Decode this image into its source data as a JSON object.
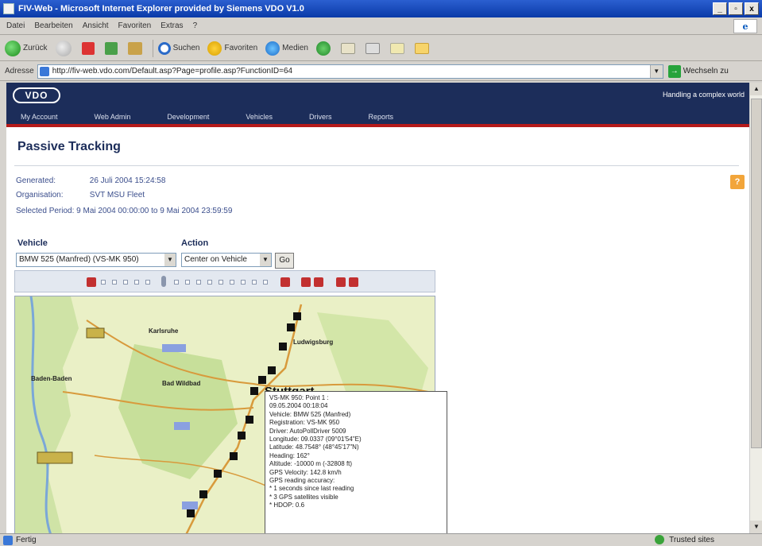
{
  "window": {
    "title": "FIV-Web - Microsoft Internet Explorer provided by Siemens VDO V1.0",
    "buttons": [
      "_",
      "▫",
      "x"
    ]
  },
  "menu": [
    "Datei",
    "Bearbeiten",
    "Ansicht",
    "Favoriten",
    "Extras",
    "?"
  ],
  "toolbar": {
    "back": "Zurück",
    "search": "Suchen",
    "favorites": "Favoriten",
    "media": "Medien"
  },
  "address": {
    "label": "Adresse",
    "url": "http://fiv-web.vdo.com/Default.asp?Page=profile.asp?FunctionID=64",
    "go_label": "Wechseln zu"
  },
  "site": {
    "logo": "VDO",
    "tagline": "Handling a complex world",
    "nav": [
      "My Account",
      "Web Admin",
      "Development",
      "Vehicles",
      "Drivers",
      "Reports"
    ]
  },
  "page": {
    "title": "Passive Tracking",
    "help": "?",
    "generated_label": "Generated:",
    "generated_value": "26 Juli 2004 15:24:58",
    "organisation_label": "Organisation:",
    "organisation_value": "SVT MSU Fleet",
    "period_label": "Selected Period:",
    "period_value": "9 Mai 2004 00:00:00 to 9 Mai 2004 23:59:59",
    "vehicle_label": "Vehicle",
    "vehicle_value": "BMW 525 (Manfred) (VS-MK 950)",
    "action_label": "Action",
    "action_value": "Center on Vehicle",
    "go_label": "Go"
  },
  "map": {
    "cities": [
      "Stuttgart",
      "Karlsruhe",
      "Bad Wildbad",
      "Baden-Baden",
      "Ludwigsburg"
    ]
  },
  "popup": {
    "lines": [
      "VS-MK 950: Point 1 :",
      "09.05.2004 00:18:04",
      "Vehicle: BMW 525 (Manfred)",
      "Registration: VS-MK 950",
      "Driver: AutoPollDriver 5009",
      "Longitude: 09.0337 (09°01'54\"E)",
      "Latitude: 48.7548° (48°45'17\"N)",
      "Heading: 162°",
      "Altitude: -10000 m (-32808 ft)",
      "GPS Velocity: 142.8 km/h",
      "GPS reading accuracy:",
      "* 1 seconds since last reading",
      "* 3 GPS satellites visible",
      "* HDOP: 0.6"
    ]
  },
  "status": {
    "left": "Fertig",
    "zone": "Trusted sites"
  }
}
